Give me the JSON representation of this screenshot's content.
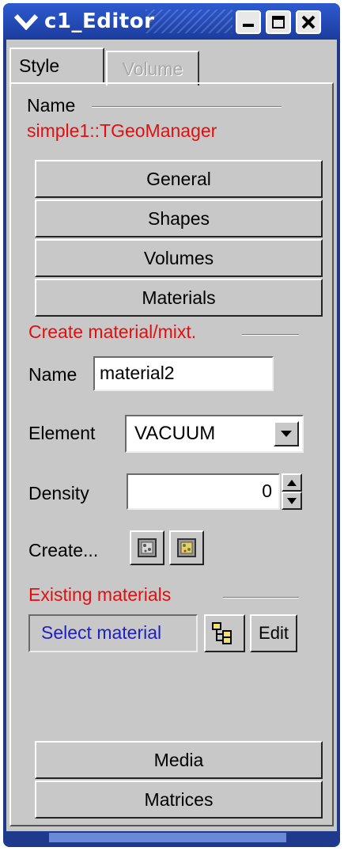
{
  "window": {
    "title": "c1_Editor"
  },
  "tabs": [
    {
      "label": "Style"
    },
    {
      "label": "Volume"
    }
  ],
  "name_section": {
    "label": "Name",
    "value": "simple1::TGeoManager"
  },
  "category_buttons": [
    "General",
    "Shapes",
    "Volumes",
    "Materials"
  ],
  "create_section": {
    "header": "Create material/mixt.",
    "name_label": "Name",
    "name_value": "material2",
    "element_label": "Element",
    "element_value": "VACUUM",
    "density_label": "Density",
    "density_value": "0",
    "create_label": "Create..."
  },
  "existing_section": {
    "header": "Existing materials",
    "select_text": "Select material",
    "edit_label": "Edit"
  },
  "bottom_buttons": [
    "Media",
    "Matrices"
  ],
  "colors": {
    "title_bar": "#2f5bd0",
    "panel_bg": "#c8c8c8",
    "section_header": "#e01010",
    "select_text": "#2020c0"
  }
}
